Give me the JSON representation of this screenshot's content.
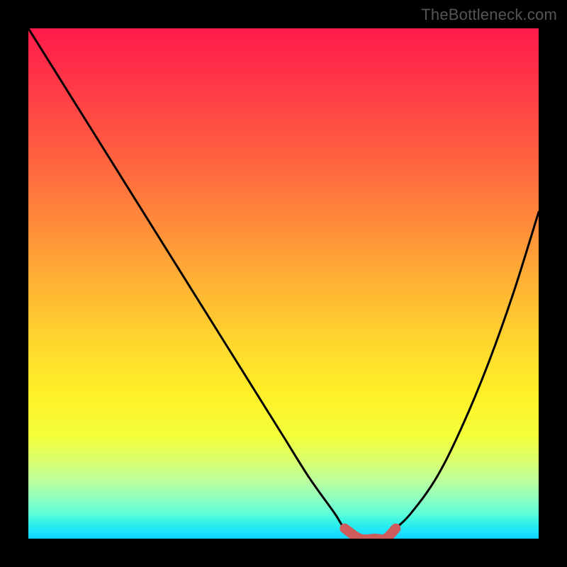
{
  "watermark": "TheBottleneck.com",
  "chart_data": {
    "type": "line",
    "title": "",
    "xlabel": "",
    "ylabel": "",
    "xlim": [
      0,
      100
    ],
    "ylim": [
      0,
      100
    ],
    "series": [
      {
        "name": "bottleneck-curve",
        "x": [
          0,
          5,
          10,
          15,
          20,
          25,
          30,
          35,
          40,
          45,
          50,
          55,
          60,
          62,
          65,
          68,
          70,
          72,
          75,
          80,
          85,
          90,
          95,
          100
        ],
        "values": [
          100,
          92,
          84,
          76,
          68,
          60,
          52,
          44,
          36,
          28,
          20,
          12,
          5,
          2,
          0,
          0,
          0,
          2,
          5,
          12,
          22,
          34,
          48,
          64
        ]
      },
      {
        "name": "optimal-range-marker",
        "x": [
          62,
          65,
          68,
          70,
          72
        ],
        "values": [
          2,
          0,
          0,
          0,
          2
        ]
      }
    ],
    "colors": {
      "curve": "#000000",
      "marker": "#cd5c5c",
      "gradient_top": "#ff1a4a",
      "gradient_bottom": "#10d0ff"
    }
  }
}
